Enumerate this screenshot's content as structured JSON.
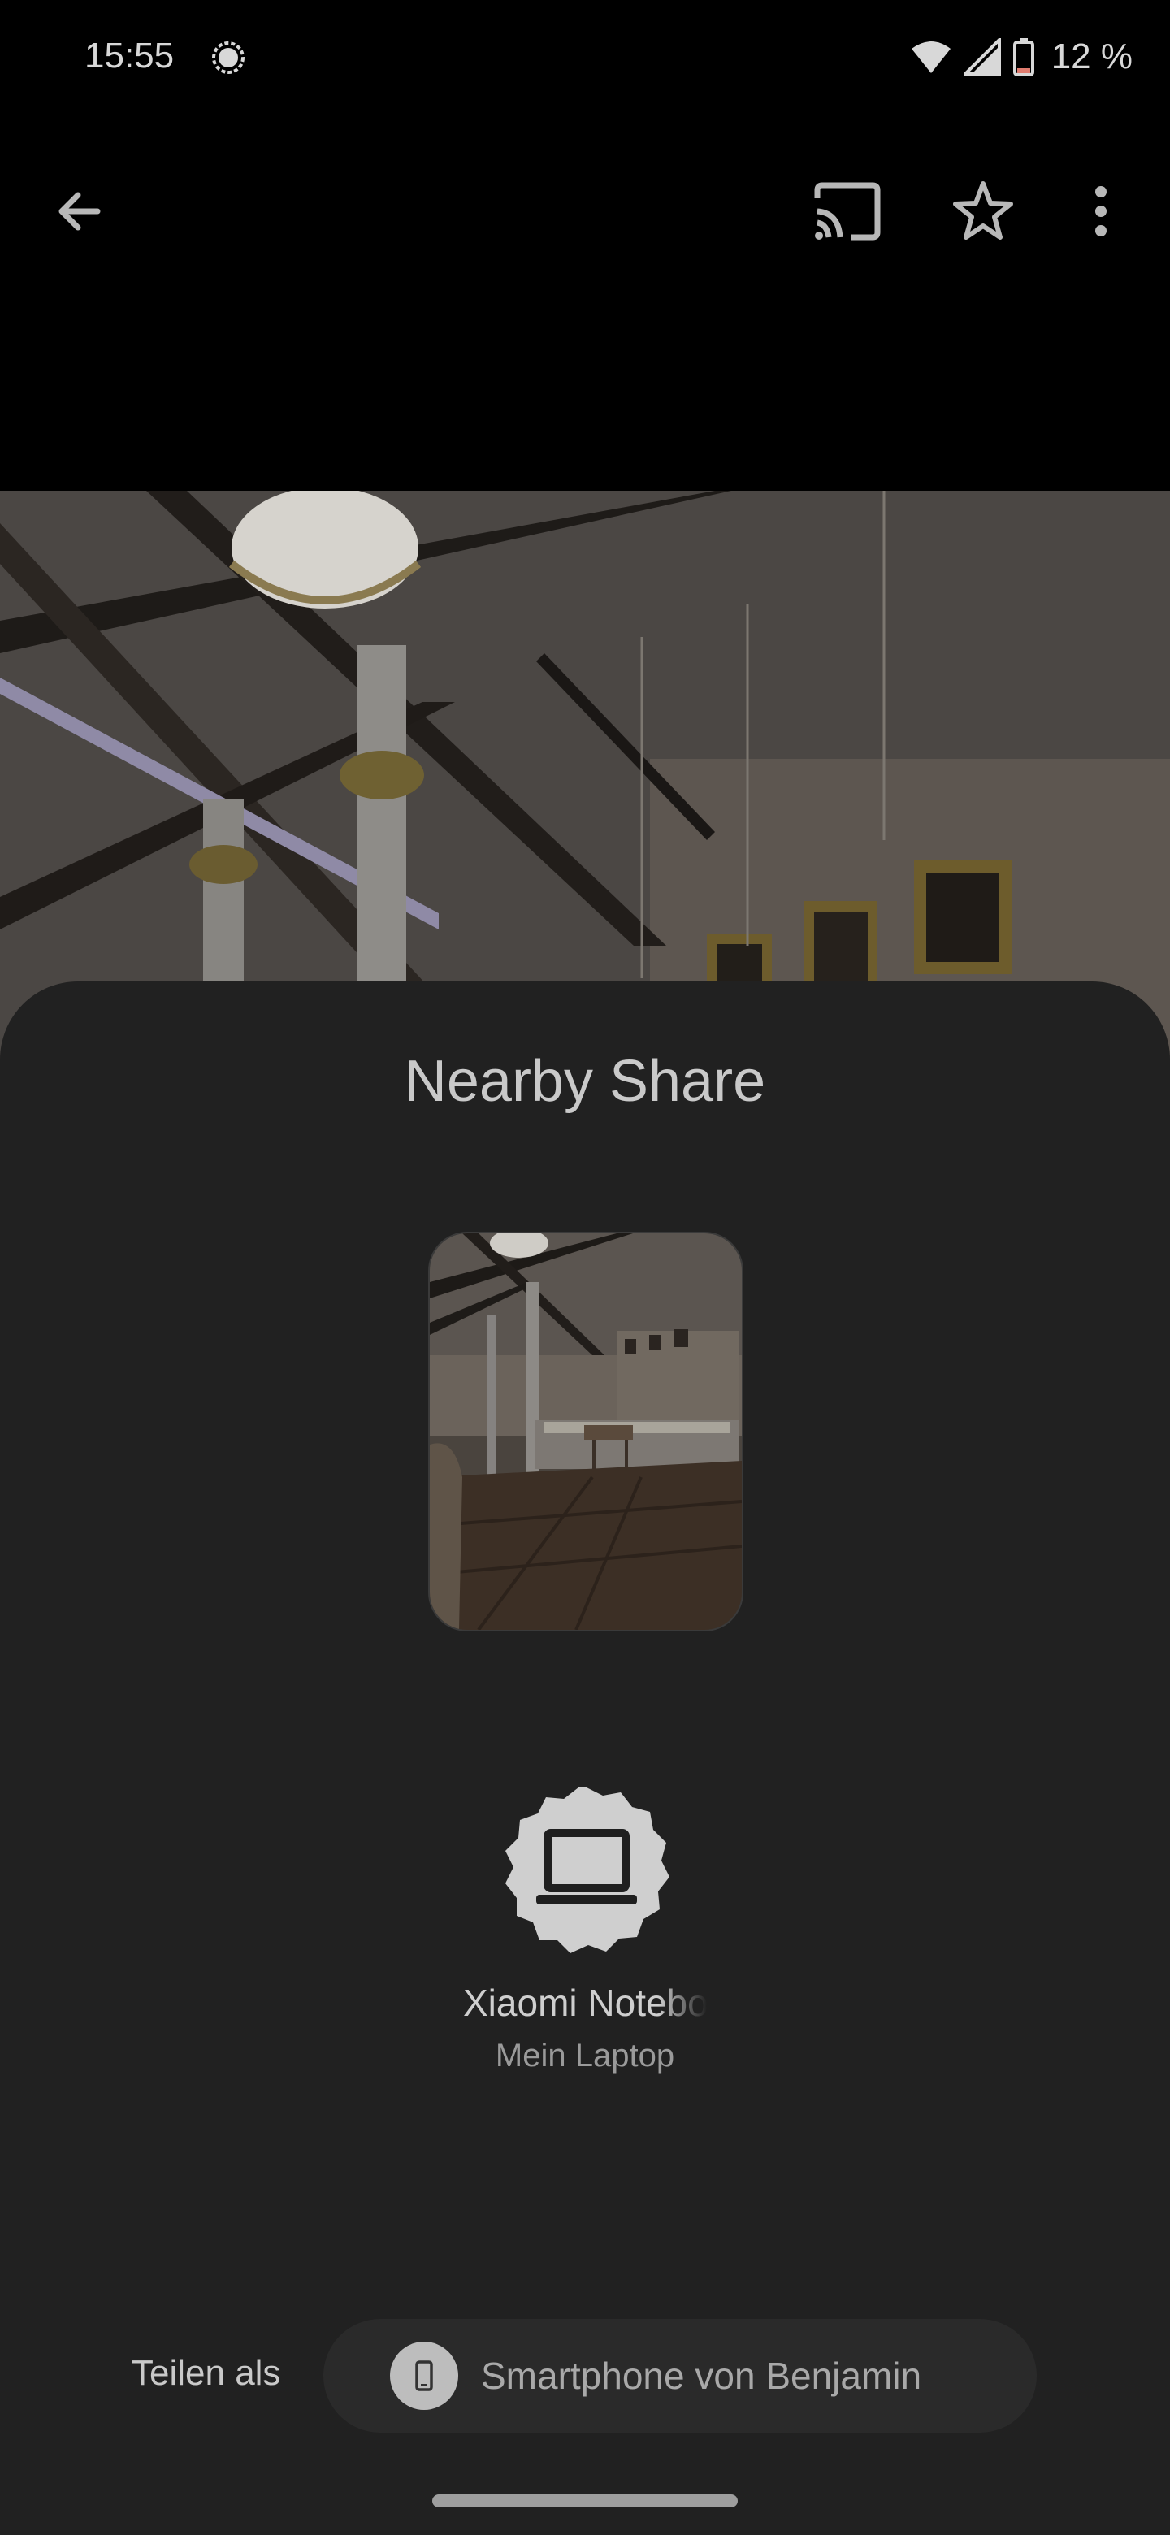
{
  "status_bar": {
    "time": "15:55",
    "battery_text": "12 %",
    "icons": [
      "signal-app-icon",
      "wifi-icon",
      "cell-signal-icon",
      "battery-icon"
    ]
  },
  "app_bar": {
    "icons": [
      "back-arrow-icon",
      "cast-icon",
      "star-icon",
      "more-vert-icon"
    ]
  },
  "sheet": {
    "title": "Nearby Share",
    "device": {
      "name": "Xiaomi Notebo",
      "subtitle": "Mein Laptop",
      "icon": "laptop-icon"
    },
    "share_as": {
      "label": "Teilen als",
      "value": "Smartphone von Benjamin",
      "icon": "smartphone-icon"
    }
  },
  "colors": {
    "sheet_bg": "#212121",
    "chip_bg": "#2a2a2a",
    "text_primary": "#c9c9c9",
    "text_secondary": "#9a9a9a",
    "avatar_bg": "#cfcfcf"
  }
}
